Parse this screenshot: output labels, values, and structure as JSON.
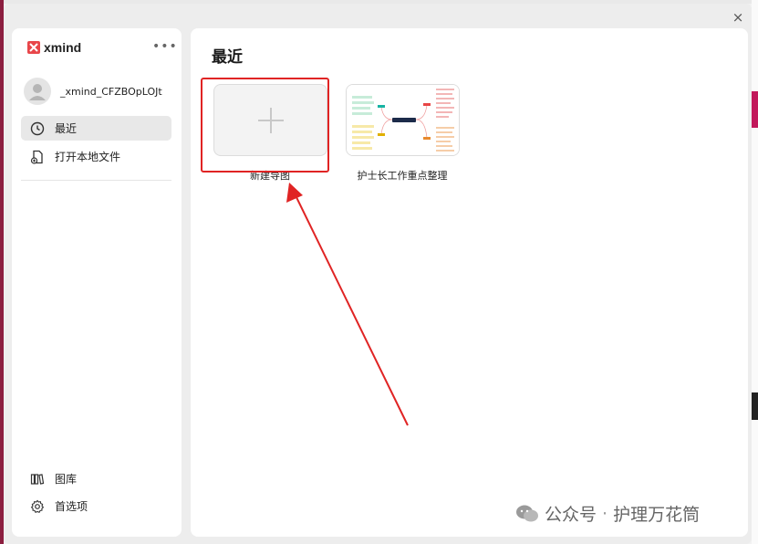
{
  "window": {
    "close_label": "×"
  },
  "sidebar": {
    "brand": "xmind",
    "more_label": "•••",
    "user_name": "_xmind_CFZBOpLOJt",
    "nav": [
      {
        "label": "最近",
        "icon": "clock-icon",
        "active": true
      },
      {
        "label": "打开本地文件",
        "icon": "open-file-icon",
        "active": false
      }
    ],
    "bottom": [
      {
        "label": "图库",
        "icon": "library-icon"
      },
      {
        "label": "首选项",
        "icon": "gear-icon"
      }
    ]
  },
  "main": {
    "title": "最近",
    "cards": [
      {
        "label": "新建导图",
        "icon": "plus-icon"
      },
      {
        "label": "护士长工作重点整理",
        "thumbnail": "mindmap-thumbnail"
      }
    ]
  },
  "watermark": {
    "platform": "公众号",
    "separator": "·",
    "account": "护理万花筒"
  },
  "colors": {
    "brand": "#e8464a",
    "highlight": "#e02424",
    "arrow": "#e02424"
  }
}
